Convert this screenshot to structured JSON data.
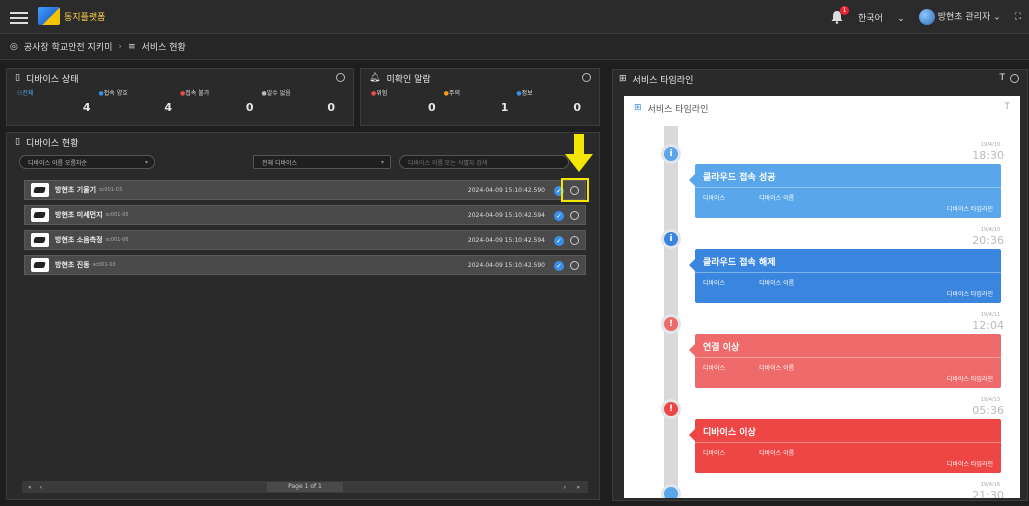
{
  "topbar": {
    "logo_text": "동지플랫폼",
    "bell_count": "1",
    "language": "한국어",
    "user": "방현초 관리자"
  },
  "breadcrumb": {
    "items": [
      "공사장 학교안전 지키미",
      "서비스 현황"
    ]
  },
  "device_status": {
    "title": "디바이스 상태",
    "labels": [
      "전체",
      "접속 양호",
      "접속 불가",
      "알수 없음"
    ],
    "values": [
      "4",
      "4",
      "0",
      "0"
    ],
    "colors": [
      "#3b8ee8",
      "#3b8ee8",
      "#e84c4c",
      "#bbbbbb"
    ]
  },
  "alarms": {
    "title": "미확인 알람",
    "labels": [
      "위험",
      "주의",
      "정보"
    ],
    "values": [
      "0",
      "1",
      "0"
    ],
    "colors": [
      "#e84c4c",
      "#f39c12",
      "#3b8ee8"
    ]
  },
  "device_list": {
    "title": "디바이스 현황",
    "filter_sort": "디바이스 이름 오름차순",
    "filter_type": "전체 디바이스",
    "search_placeholder": "디바이스 이름 또는 식별자 검색",
    "rows": [
      {
        "name": "방현초 기울기",
        "id": "sc001-03",
        "time": "2024-04-09 15:10:42.590"
      },
      {
        "name": "방현초 미세먼지",
        "id": "sc001-05",
        "time": "2024-04-09 15:10:42.594"
      },
      {
        "name": "방현초 소음측정",
        "id": "sc001-06",
        "time": "2024-04-09 15:10:42.594"
      },
      {
        "name": "방현초 진동",
        "id": "sc001-03",
        "time": "2024-04-09 15:10:42.590"
      }
    ],
    "pager": {
      "first": "«",
      "prev": "‹",
      "page": "Page 1 of 1",
      "next": "›",
      "last": "»"
    }
  },
  "timeline": {
    "title": "서비스 타임라인",
    "inner_title": "서비스 타임라인",
    "events": [
      {
        "title": "클라우드 접속 성공",
        "date": "19/4/10",
        "time": "18:30",
        "label": "디바이스",
        "value": "디바이스 이름",
        "link": "디바이스 타임라인",
        "color": "#5aa6ea",
        "dot": "i"
      },
      {
        "title": "클라우드 접속 해제",
        "date": "19/4/10",
        "time": "20:36",
        "label": "디바이스",
        "value": "디바이스 이름",
        "link": "디바이스 타임라인",
        "color": "#3a86de",
        "dot": "i"
      },
      {
        "title": "연결 이상",
        "date": "19/4/11",
        "time": "12:04",
        "label": "디바이스",
        "value": "디바이스 이름",
        "link": "디바이스 타임라인",
        "color": "#ef6a6a",
        "dot": "!"
      },
      {
        "title": "디바이스 이상",
        "date": "19/4/13",
        "time": "05:36",
        "label": "디바이스",
        "value": "디바이스 이름",
        "link": "디바이스 타임라인",
        "color": "#ee4545",
        "dot": "!"
      }
    ],
    "partial_date": "19/4/16",
    "partial_time": "21:30"
  }
}
